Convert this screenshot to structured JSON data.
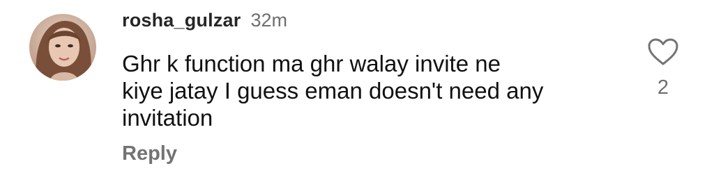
{
  "comment": {
    "username": "rosha_gulzar",
    "time": "32m",
    "text_lines": [
      "Ghr k function ma ghr walay invite ne",
      "kiye jatay I guess eman doesn't need any",
      "invitation"
    ],
    "reply_label": "Reply",
    "like_count": "2",
    "like_icon": "heart-outline-icon"
  }
}
